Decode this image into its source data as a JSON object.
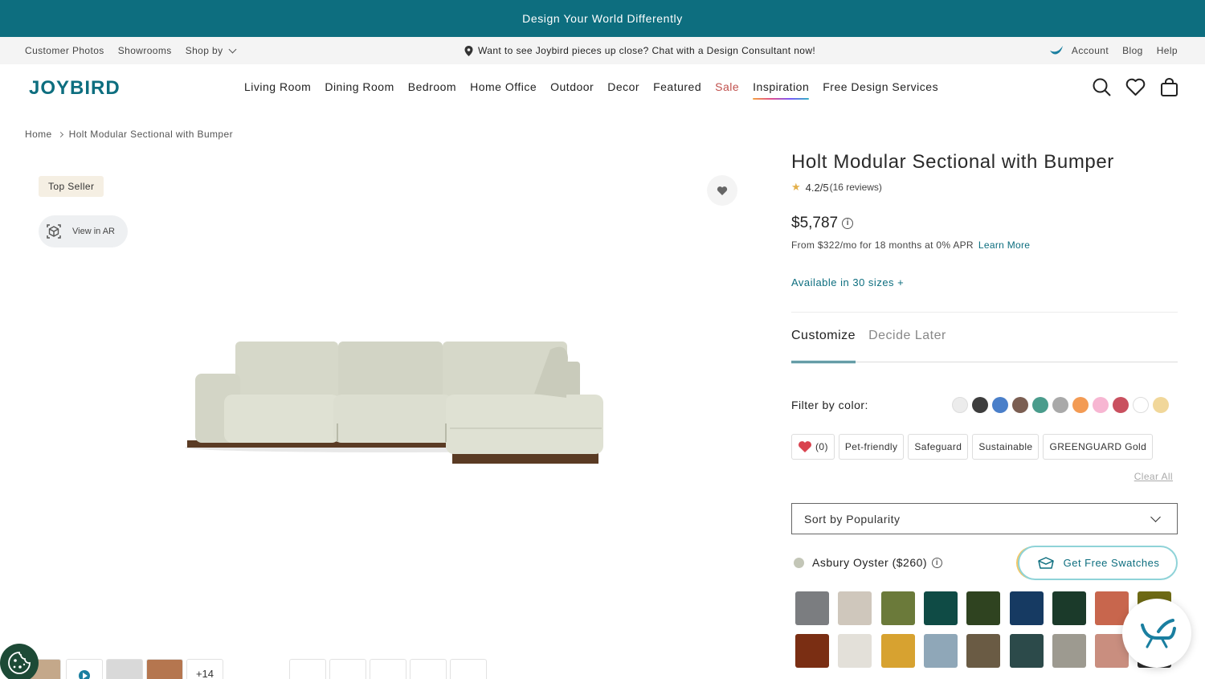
{
  "promo": {
    "text": "Design Your World Differently"
  },
  "utility": {
    "left": [
      "Customer Photos",
      "Showrooms",
      "Shop by"
    ],
    "center": "Want to see Joybird pieces up close? Chat with a Design Consultant now!",
    "right": [
      "Account",
      "Blog",
      "Help"
    ]
  },
  "logo": "JOYBIRD",
  "nav": [
    "Living Room",
    "Dining Room",
    "Bedroom",
    "Home Office",
    "Outdoor",
    "Decor",
    "Featured",
    "Sale",
    "Inspiration",
    "Free Design Services"
  ],
  "breadcrumb": {
    "home": "Home",
    "current": "Holt Modular Sectional with Bumper"
  },
  "gallery": {
    "badge": "Top Seller",
    "ar_label": "View in AR",
    "more_count": "+14"
  },
  "product": {
    "title": "Holt Modular Sectional with Bumper",
    "rating": "4.2/5",
    "reviews": "(16 reviews)",
    "price": "$5,787",
    "financing": "From $322/mo for 18 months at 0% APR",
    "learn_more": "Learn More",
    "sizes": "Available in 30 sizes +"
  },
  "tabs": {
    "customize": "Customize",
    "decide_later": "Decide Later"
  },
  "filter": {
    "label": "Filter by color:",
    "colors": [
      "#ececec",
      "#3d3d3d",
      "#4a7fc9",
      "#7b5e52",
      "#4a9c8c",
      "#a9a9a9",
      "#f39b54",
      "#f7b6d2",
      "#c9505f",
      "#ffffff",
      "#f1d79a"
    ],
    "chips": [
      "(0)",
      "Pet-friendly",
      "Safeguard",
      "Sustainable",
      "GREENGUARD Gold"
    ],
    "clear_all": "Clear All"
  },
  "sort": {
    "value": "Sort by Popularity"
  },
  "fabric": {
    "selected": "Asbury Oyster ($260)",
    "get_swatches": "Get Free Swatches",
    "swatches": [
      "#7b7d80",
      "#cfc7bc",
      "#6b7a3a",
      "#0f4b45",
      "#2f4320",
      "#163a62",
      "#1b3a2a",
      "#c8664d",
      "#6e6a15",
      "#7a2e13",
      "#e3e0d9",
      "#d7a230",
      "#8fa7b8",
      "#6a5b44",
      "#2c4a4a",
      "#9d9a90",
      "#c98e7f",
      "#2a2a2a"
    ]
  },
  "accent": "#0d6e7f"
}
